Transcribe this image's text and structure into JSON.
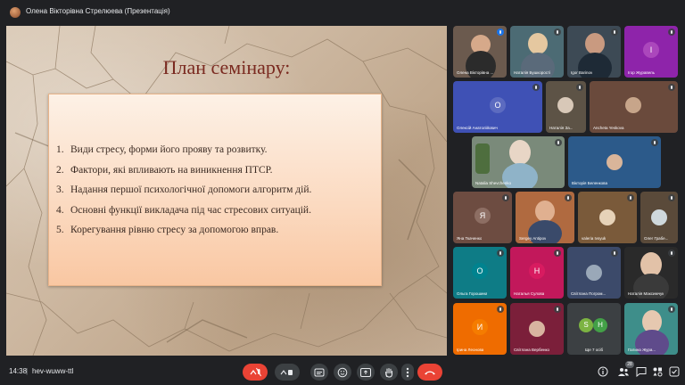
{
  "header": {
    "presenter_label": "Олена Вікторівна Стрелюева (Презентація)"
  },
  "slide": {
    "title": "План семінару:",
    "items": [
      {
        "num": "1.",
        "text": "Види стресу,   форми його прояву та розвитку."
      },
      {
        "num": "2.",
        "text": "Фактори, які впливають на виникнення ПТСР."
      },
      {
        "num": "3.",
        "text": "Надання першої психологічної допомоги алгоритм дій."
      },
      {
        "num": "4.",
        "text": "Основні функції викладача під час стресових ситуацій."
      },
      {
        "num": "5.",
        "text": "Корегування рівню стресу за допомогою вправ."
      }
    ]
  },
  "participants": [
    {
      "name": "Олена Вікторівна ...",
      "color": "#6b5a4e"
    },
    {
      "name": "Наталія Бушкорості",
      "color": "#4c6b74"
    },
    {
      "name": "Igor Barinov",
      "color": "#3d4a55"
    },
    {
      "name": "Ігор Журавель",
      "color": "#8e24aa",
      "initial": "І"
    },
    {
      "name": "Олексій Анатолійович",
      "color": "#3f51b5",
      "initial": "О"
    },
    {
      "name": "Наталія За...",
      "color": "#5d5346"
    },
    {
      "name": "Ancheta Yeskova",
      "color": "#6a4a3c"
    },
    {
      "name": "Natalia Shevchenko",
      "color": "#7a8a7a"
    },
    {
      "name": "Вікторія Беленкова",
      "color": "#2c5a8a"
    },
    {
      "name": "Яна Ткаченко",
      "color": "#6d4c41",
      "initial": "Я"
    },
    {
      "name": "Sergey Antipov",
      "color": "#b06a40"
    },
    {
      "name": "valeria Ivsyuk",
      "color": "#7a5a3a"
    },
    {
      "name": "Олег Грабе...",
      "color": "#5a4a3a"
    },
    {
      "name": "Ольга Горошина",
      "color": "#0e7c86",
      "initial": "О"
    },
    {
      "name": "Наталья Сулова",
      "color": "#c2185b",
      "initial": "Н"
    },
    {
      "name": "Світлана Погром...",
      "color": "#3c4a6a"
    },
    {
      "name": "Наталія Максимчук",
      "color": "#2a2a2a"
    },
    {
      "name": "Ірина Леонова",
      "color": "#ef6c00",
      "initial": "И"
    },
    {
      "name": "Світлана Вербенко",
      "color": "#7b1f3a"
    },
    {
      "name": "Ще 7 осіб",
      "color": "#3c4043",
      "initials": [
        "S",
        "H"
      ]
    },
    {
      "name": "Галина Жура...",
      "color": "#3e8e8a"
    }
  ],
  "footer": {
    "time": "14:38",
    "separator": "|",
    "meeting_code": "hev-wuww-ttl",
    "participant_count": "28"
  },
  "colors": {
    "background": "#202124",
    "control": "#3c4043",
    "end_call": "#ea4335",
    "slide_title": "#7a2a20"
  }
}
